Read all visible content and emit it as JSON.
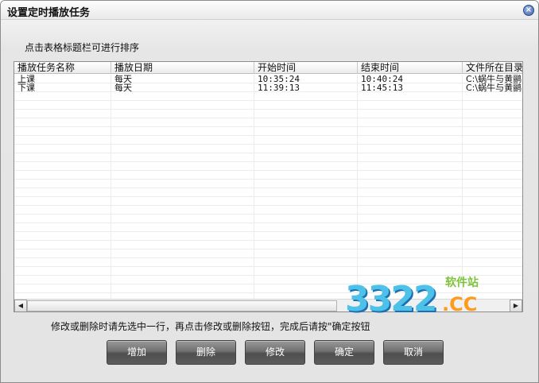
{
  "window": {
    "title": "设置定时播放任务",
    "close_glyph": "×"
  },
  "hint_top": "点击表格标题栏可进行排序",
  "table": {
    "columns": [
      "播放任务名称",
      "播放日期",
      "开始时间",
      "结束时间",
      "文件所在目录"
    ],
    "rows": [
      [
        "上课",
        "每天",
        "10:35:24",
        "10:40:24",
        "C:\\蜗牛与黄鹂"
      ],
      [
        "下课",
        "每天",
        "11:39:13",
        "11:45:13",
        "C:\\蜗牛与黄鹂"
      ]
    ]
  },
  "scrollbar": {
    "left_arrow": "◀",
    "right_arrow": "▶"
  },
  "hint_bottom": "修改或删除时请先选中一行，再点击修改或删除按钮，完成后请按\"确定按钮",
  "buttons": {
    "add": "增加",
    "delete": "删除",
    "modify": "修改",
    "ok": "确定",
    "cancel": "取消"
  },
  "watermark": {
    "number": "3322",
    "domain": ".CC",
    "label": "软件站"
  },
  "colors": {
    "button_bg": "#5d5d5d",
    "watermark_blue": "#4ec1e8",
    "watermark_orange": "#ff9a1a",
    "watermark_green": "#7cc33a"
  }
}
